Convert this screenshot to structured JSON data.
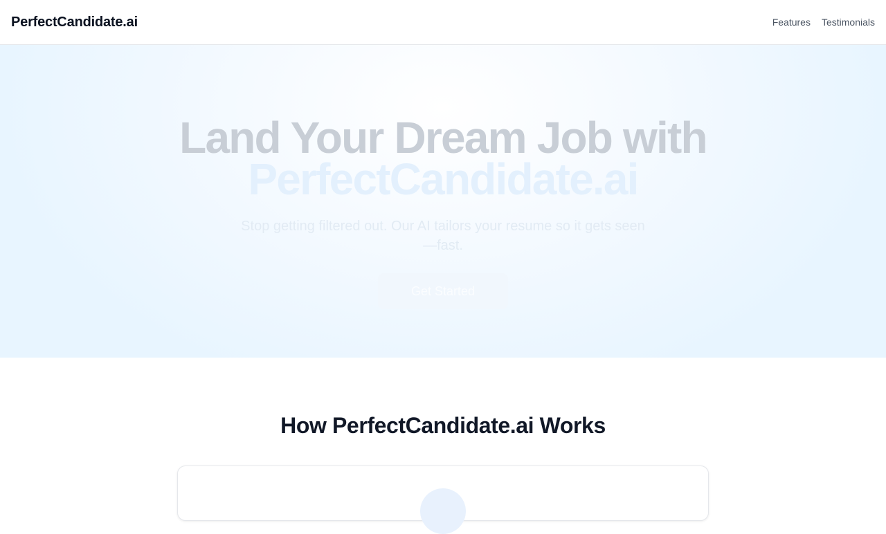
{
  "header": {
    "logo": "PerfectCandidate.ai",
    "nav": [
      {
        "label": "Features"
      },
      {
        "label": "Testimonials"
      }
    ]
  },
  "hero": {
    "title_line1": "Land Your Dream Job with",
    "title_accent": "PerfectCandidate.ai",
    "subtitle": "Stop getting filtered out. Our AI tailors your resume so it gets seen—fast.",
    "cta_label": "Get Started"
  },
  "how": {
    "title": "How PerfectCandidate.ai Works"
  }
}
